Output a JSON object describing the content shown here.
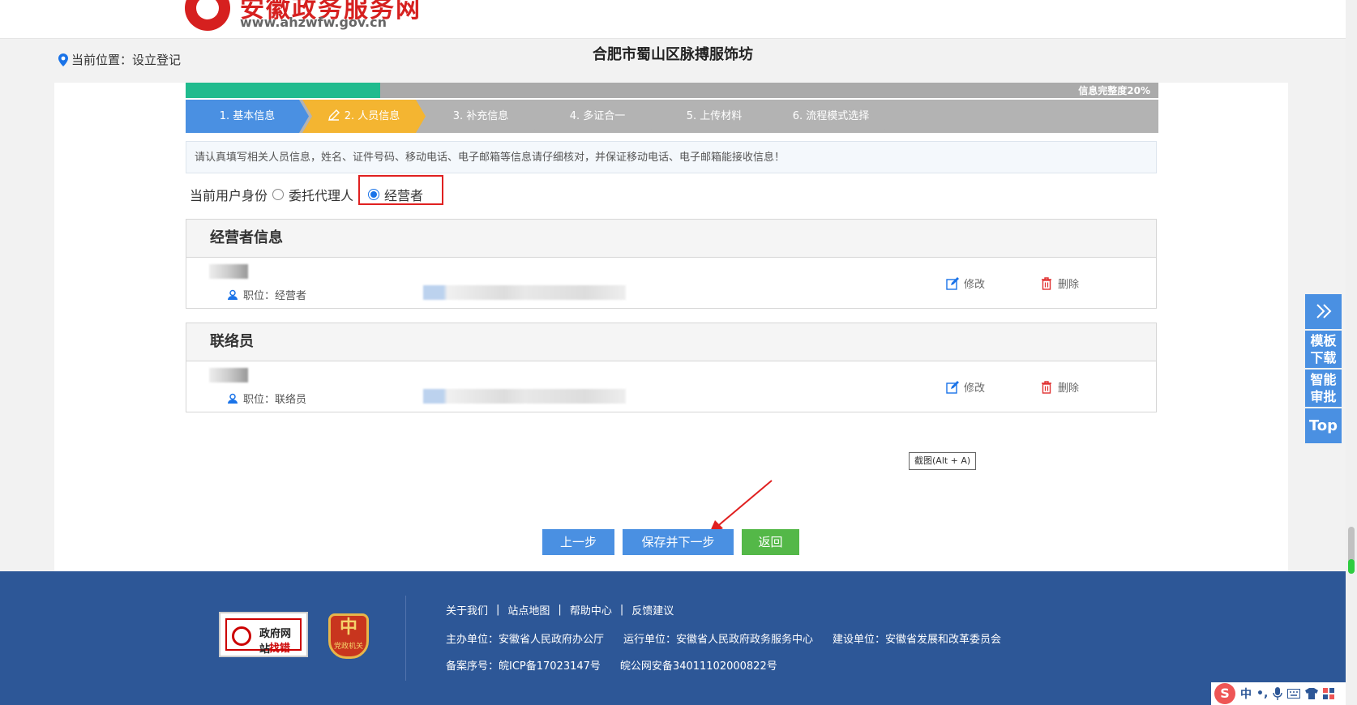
{
  "header": {
    "site_title": "安徽政务服务网",
    "site_url": "www.ahzwfw.gov.cn"
  },
  "breadcrumb": {
    "prefix": "当前位置：",
    "current": "设立登记"
  },
  "page_title": "合肥市蜀山区脉搏服饰坊",
  "progress": {
    "label": "信息完整度20%",
    "percent": 20
  },
  "steps": [
    {
      "label": "1. 基本信息",
      "state": "done"
    },
    {
      "label": "2. 人员信息",
      "state": "active"
    },
    {
      "label": "3. 补充信息",
      "state": "todo"
    },
    {
      "label": "4. 多证合一",
      "state": "todo"
    },
    {
      "label": "5. 上传材料",
      "state": "todo"
    },
    {
      "label": "6. 流程模式选择",
      "state": "todo"
    }
  ],
  "notice": "请认真填写相关人员信息，姓名、证件号码、移动电话、电子邮箱等信息请仔细核对，并保证移动电话、电子邮箱能接收信息！",
  "identity": {
    "label": "当前用户身份",
    "options": [
      "委托代理人",
      "经营者"
    ],
    "selected": "经营者"
  },
  "operator_panel": {
    "title": "经营者信息",
    "role": "职位：经营者",
    "edit": "修改",
    "delete": "删除"
  },
  "contact_panel": {
    "title": "联络员",
    "role": "职位：联络员",
    "edit": "修改",
    "delete": "删除"
  },
  "tooltip": "截图(Alt + A)",
  "buttons": {
    "prev": "上一步",
    "save_next": "保存并下一步",
    "back": "返回"
  },
  "side_tools": {
    "templates": "模板下载",
    "smart_review": "智能审批",
    "top": "Top"
  },
  "footer": {
    "badge_gov_l1": "政府网站",
    "badge_gov_l2": "找错",
    "badge_party": "党政机关",
    "links": [
      "关于我们",
      "站点地图",
      "帮助中心",
      "反馈建议"
    ],
    "sponsor": "主办单位：安徽省人民政府办公厅",
    "operator": "运行单位：安徽省人民政府政务服务中心",
    "builder": "建设单位：安徽省发展和改革委员会",
    "icp": "备案序号：皖ICP备17023147号",
    "police": "皖公网安备34011102000822号"
  },
  "ime": {
    "lang": "中"
  },
  "colors": {
    "primary": "#4a90e2",
    "active_step": "#f4b531",
    "progress": "#20bb8e",
    "footer": "#2d5797",
    "brand_red": "#d6201f",
    "back_button": "#54b848"
  }
}
